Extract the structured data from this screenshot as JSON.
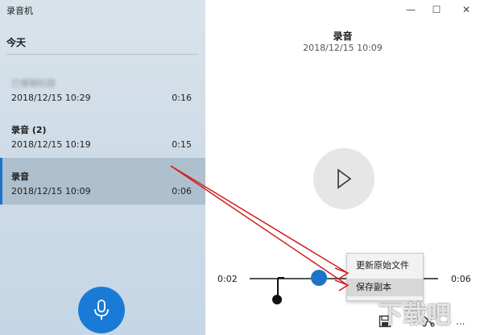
{
  "app": {
    "title": "录音机"
  },
  "sidebar": {
    "section": "今天",
    "recordings": [
      {
        "name": "已模糊标题",
        "date": "2018/12/15 10:29",
        "duration": "0:16"
      },
      {
        "name": "录音 (2)",
        "date": "2018/12/15 10:19",
        "duration": "0:15"
      },
      {
        "name": "录音",
        "date": "2018/12/15 10:09",
        "duration": "0:06"
      }
    ]
  },
  "window_controls": {
    "minimize": "—",
    "maximize": "☐",
    "close": "✕"
  },
  "player": {
    "title": "录音",
    "date": "2018/12/15 10:09",
    "current_time": "0:02",
    "total_time": "0:06",
    "progress": 0.33
  },
  "context_menu": {
    "items": [
      "更新原始文件",
      "保存副本"
    ]
  },
  "bottom": {
    "more": "..."
  },
  "watermark": "下载吧"
}
